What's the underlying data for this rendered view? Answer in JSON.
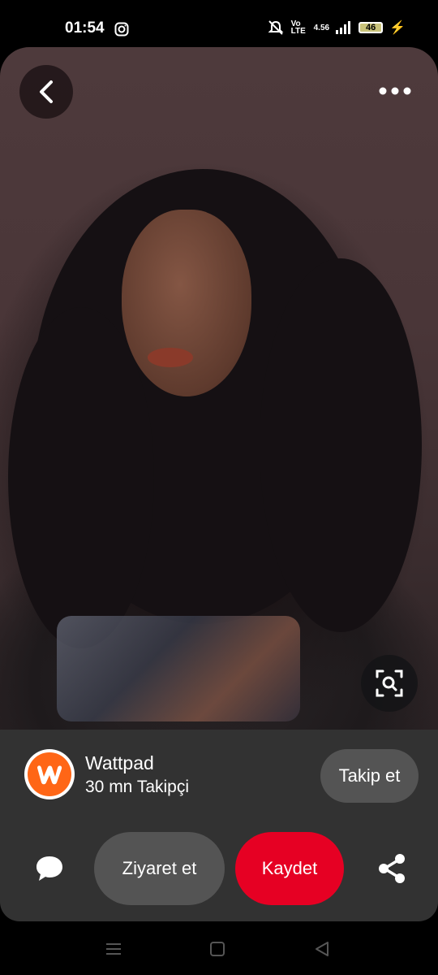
{
  "status_bar": {
    "time": "01:54",
    "battery": "46",
    "network_volte": "Vo LTE",
    "network_speed": "4.56",
    "icons": [
      "instagram-icon",
      "mute-icon",
      "signal-icon",
      "battery-icon",
      "charging-icon"
    ]
  },
  "pin": {
    "actions": {
      "back_icon": "chevron-left-icon",
      "more_icon": "more-dots-icon",
      "lens_icon": "visual-search-icon"
    }
  },
  "profile": {
    "name": "Wattpad",
    "followers": "30 mn Takipçi",
    "follow_label": "Takip et",
    "avatar_letter": "W",
    "brand_color": "#ff6616"
  },
  "actions": {
    "visit_label": "Ziyaret et",
    "save_label": "Kaydet",
    "save_color": "#e60023",
    "comment_icon": "comment-icon",
    "share_icon": "share-icon"
  },
  "nav": {
    "items": [
      "menu-icon",
      "home-icon",
      "back-icon"
    ]
  }
}
